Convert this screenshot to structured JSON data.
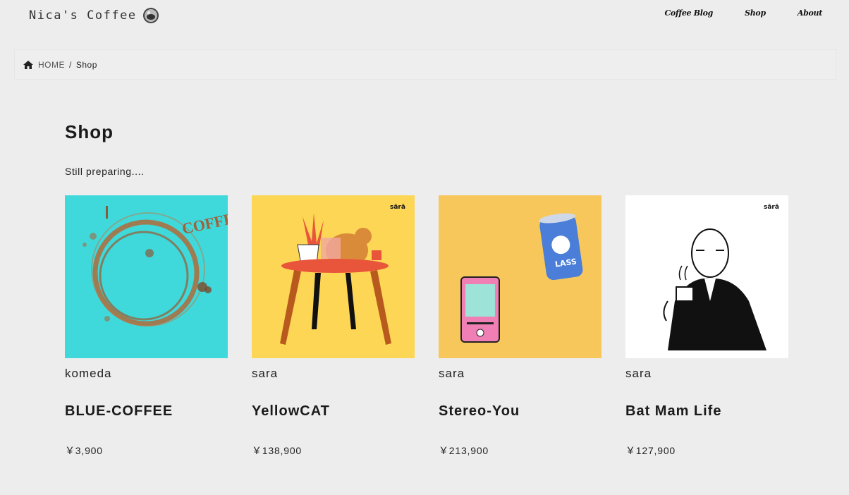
{
  "header": {
    "logo_text": "Nica's Coffee",
    "nav": [
      {
        "label": "Coffee Blog"
      },
      {
        "label": "Shop"
      },
      {
        "label": "About"
      }
    ]
  },
  "breadcrumb": {
    "home_label": "HOME",
    "separator": "/",
    "current": "Shop"
  },
  "main": {
    "title": "Shop",
    "intro": "Still preparing....",
    "products": [
      {
        "seller": "komeda",
        "name": "BLUE-COFFEE",
        "price": "￥3,900",
        "image_bg": "#3fd9dc",
        "image_text": "COFFEE"
      },
      {
        "seller": "sara",
        "name": "YellowCAT",
        "price": "￥138,900",
        "image_bg": "#fdd655",
        "image_text": "sārā"
      },
      {
        "seller": "sara",
        "name": "Stereo-You",
        "price": "￥213,900",
        "image_bg": "#f8c75c",
        "image_text": "LASS"
      },
      {
        "seller": "sara",
        "name": "Bat Mam Life",
        "price": "￥127,900",
        "image_bg": "#ffffff",
        "image_text": "sārā"
      }
    ]
  },
  "colors": {
    "background": "#ededed",
    "text": "#1a1a1a"
  }
}
